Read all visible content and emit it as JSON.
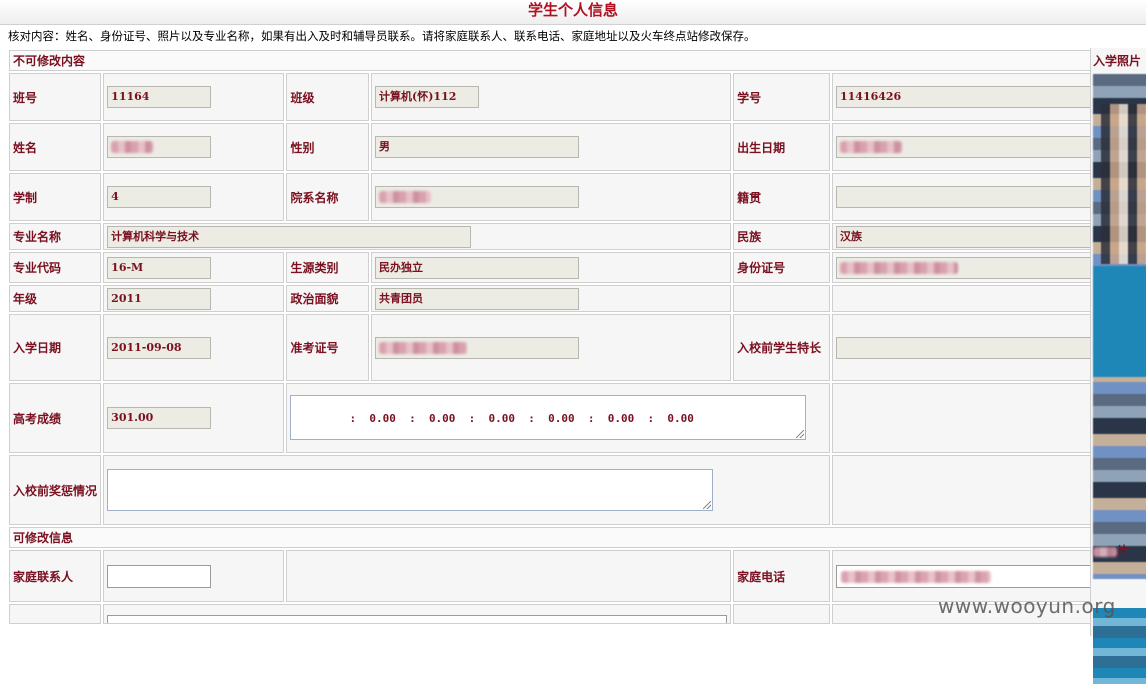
{
  "page": {
    "title": "学生个人信息",
    "notice": "核对内容：姓名、身份证号、照片以及专业名称，如果有出入及时和辅导员联系。请将家庭联系人、联系电话、家庭地址以及火车终点站修改保存。"
  },
  "readonly_section": {
    "header": "不可修改内容",
    "labels": {
      "class_no": "班号",
      "class": "班级",
      "student_id": "学号",
      "name": "姓名",
      "gender": "性别",
      "birth_date": "出生日期",
      "years": "学制",
      "department": "院系名称",
      "native_place": "籍贯",
      "major": "专业名称",
      "ethnicity": "民族",
      "major_code": "专业代码",
      "source_type": "生源类别",
      "id_card": "身份证号",
      "grade": "年级",
      "political_status": "政治面貌",
      "enroll_date": "入学日期",
      "exam_no": "准考证号",
      "talent": "入校前学生特长",
      "gaokao_score": "高考成绩",
      "awards": "入校前奖惩情况"
    },
    "values": {
      "class_no": "11164",
      "class": "计算机(怀)112",
      "student_id": "11416426",
      "gender": "男",
      "years": "4",
      "native_place": "",
      "major": "计算机科学与技术",
      "ethnicity": "汉族",
      "major_code": "16-M",
      "source_type": "民办独立",
      "grade": "2011",
      "political_status": "共青团员",
      "enroll_date": "2011-09-08",
      "talent": "",
      "gaokao_score": "301.00",
      "score_breakdown": ":  0.00  :  0.00  :  0.00  :  0.00  :  0.00  :  0.00",
      "awards": ""
    }
  },
  "editable_section": {
    "header": "可修改信息",
    "labels": {
      "family_contact": "家庭联系人",
      "family_phone": "家庭电话"
    },
    "values": {
      "family_contact": ""
    }
  },
  "photo": {
    "label": "入学照片",
    "label_partial": "片"
  },
  "watermark": "www.wooyun.org"
}
